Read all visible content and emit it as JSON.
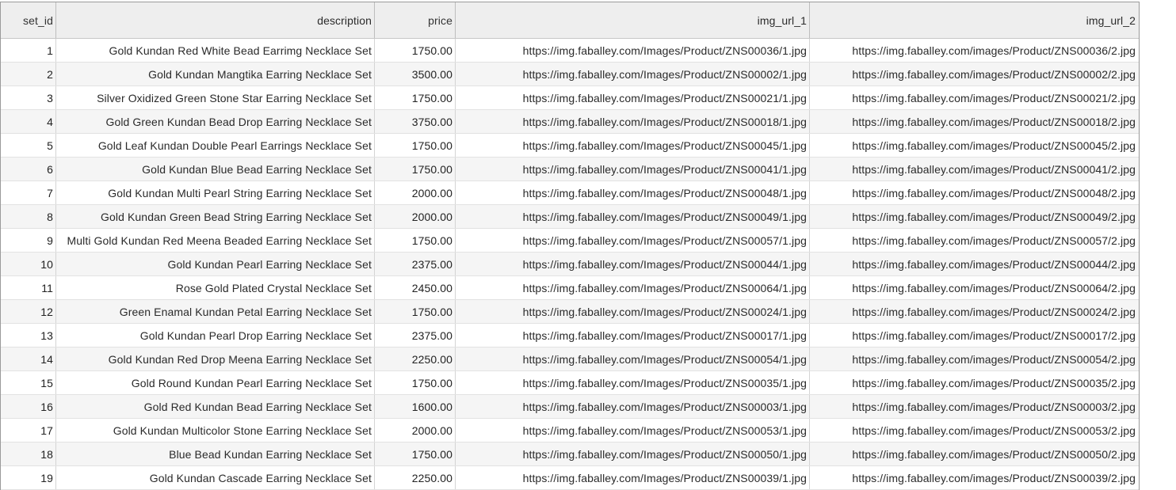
{
  "columns": [
    "set_id",
    "description",
    "price",
    "img_url_1",
    "img_url_2"
  ],
  "rows": [
    [
      "1",
      "Gold Kundan Red White Bead Earrimg Necklace Set",
      "1750.00",
      "https://img.faballey.com/Images/Product/ZNS00036/1.jpg",
      "https://img.faballey.com/images/Product/ZNS00036/2.jpg"
    ],
    [
      "2",
      "Gold Kundan Mangtika Earring Necklace Set",
      "3500.00",
      "https://img.faballey.com/Images/Product/ZNS00002/1.jpg",
      "https://img.faballey.com/images/Product/ZNS00002/2.jpg"
    ],
    [
      "3",
      "Silver Oxidized Green Stone Star Earring Necklace Set",
      "1750.00",
      "https://img.faballey.com/Images/Product/ZNS00021/1.jpg",
      "https://img.faballey.com/images/Product/ZNS00021/2.jpg"
    ],
    [
      "4",
      "Gold Green Kundan Bead Drop Earring Necklace Set",
      "3750.00",
      "https://img.faballey.com/Images/Product/ZNS00018/1.jpg",
      "https://img.faballey.com/images/Product/ZNS00018/2.jpg"
    ],
    [
      "5",
      "Gold Leaf Kundan Double Pearl Earrings Necklace Set",
      "1750.00",
      "https://img.faballey.com/Images/Product/ZNS00045/1.jpg",
      "https://img.faballey.com/images/Product/ZNS00045/2.jpg"
    ],
    [
      "6",
      "Gold Kundan Blue Bead Earring Necklace Set",
      "1750.00",
      "https://img.faballey.com/Images/Product/ZNS00041/1.jpg",
      "https://img.faballey.com/images/Product/ZNS00041/2.jpg"
    ],
    [
      "7",
      "Gold Kundan Multi Pearl String Earring Necklace Set",
      "2000.00",
      "https://img.faballey.com/Images/Product/ZNS00048/1.jpg",
      "https://img.faballey.com/images/Product/ZNS00048/2.jpg"
    ],
    [
      "8",
      "Gold Kundan Green Bead String Earring Necklace Set",
      "2000.00",
      "https://img.faballey.com/Images/Product/ZNS00049/1.jpg",
      "https://img.faballey.com/images/Product/ZNS00049/2.jpg"
    ],
    [
      "9",
      "Multi Gold Kundan Red Meena Beaded Earring Necklace Set",
      "1750.00",
      "https://img.faballey.com/Images/Product/ZNS00057/1.jpg",
      "https://img.faballey.com/images/Product/ZNS00057/2.jpg"
    ],
    [
      "10",
      "Gold Kundan Pearl Earring Necklace Set",
      "2375.00",
      "https://img.faballey.com/Images/Product/ZNS00044/1.jpg",
      "https://img.faballey.com/images/Product/ZNS00044/2.jpg"
    ],
    [
      "11",
      "Rose Gold Plated  Crystal Necklace Set",
      "2450.00",
      "https://img.faballey.com/Images/Product/ZNS00064/1.jpg",
      "https://img.faballey.com/images/Product/ZNS00064/2.jpg"
    ],
    [
      "12",
      "Green Enamal Kundan Petal Earring Necklace Set",
      "1750.00",
      "https://img.faballey.com/Images/Product/ZNS00024/1.jpg",
      "https://img.faballey.com/images/Product/ZNS00024/2.jpg"
    ],
    [
      "13",
      "Gold Kundan Pearl Drop Earring  Necklace Set",
      "2375.00",
      "https://img.faballey.com/Images/Product/ZNS00017/1.jpg",
      "https://img.faballey.com/images/Product/ZNS00017/2.jpg"
    ],
    [
      "14",
      "Gold Kundan Red Drop Meena Earring Necklace Set",
      "2250.00",
      "https://img.faballey.com/Images/Product/ZNS00054/1.jpg",
      "https://img.faballey.com/images/Product/ZNS00054/2.jpg"
    ],
    [
      "15",
      "Gold Round Kundan Pearl Earring Necklace Set",
      "1750.00",
      "https://img.faballey.com/Images/Product/ZNS00035/1.jpg",
      "https://img.faballey.com/images/Product/ZNS00035/2.jpg"
    ],
    [
      "16",
      "Gold Red Kundan Bead Earring Necklace Set",
      "1600.00",
      "https://img.faballey.com/Images/Product/ZNS00003/1.jpg",
      "https://img.faballey.com/images/Product/ZNS00003/2.jpg"
    ],
    [
      "17",
      "Gold Kundan Multicolor Stone Earring Necklace Set",
      "2000.00",
      "https://img.faballey.com/Images/Product/ZNS00053/1.jpg",
      "https://img.faballey.com/images/Product/ZNS00053/2.jpg"
    ],
    [
      "18",
      "Blue Bead Kundan Earring Necklace Set",
      "1750.00",
      "https://img.faballey.com/Images/Product/ZNS00050/1.jpg",
      "https://img.faballey.com/images/Product/ZNS00050/2.jpg"
    ],
    [
      "19",
      "Gold Kundan Cascade Earring Necklace Set",
      "2250.00",
      "https://img.faballey.com/Images/Product/ZNS00039/1.jpg",
      "https://img.faballey.com/images/Product/ZNS00039/2.jpg"
    ]
  ]
}
